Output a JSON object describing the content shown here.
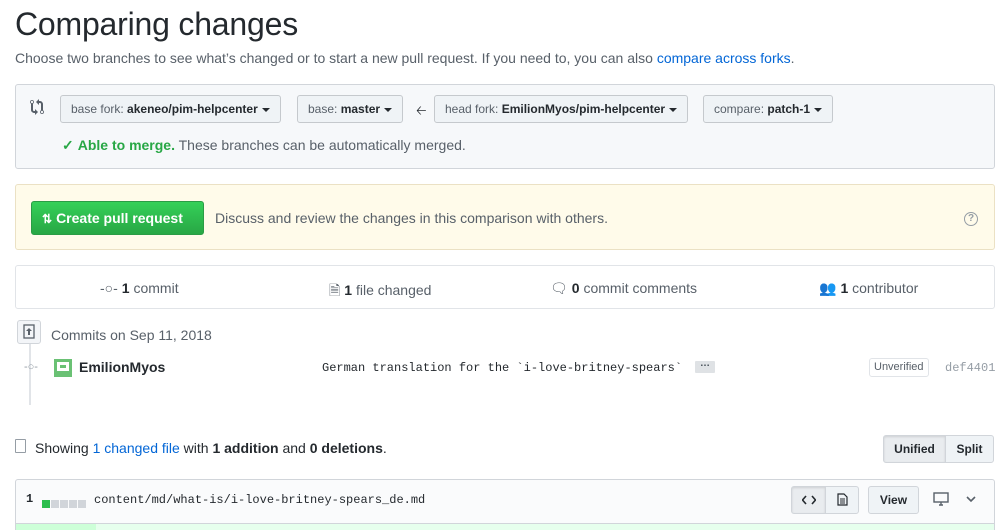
{
  "header": {
    "title": "Comparing changes",
    "subtitle": "Choose two branches to see what’s changed or to start a new pull request. If you need to, you can also ",
    "subtitle_link": "compare across forks",
    "subtitle_end": "."
  },
  "range": {
    "base_fork_label": "base fork:",
    "base_fork_value": "akeneo/pim-helpcenter",
    "base_label": "base:",
    "base_value": "master",
    "head_fork_label": "head fork:",
    "head_fork_value": "EmilionMyos/pim-helpcenter",
    "compare_label": "compare:",
    "compare_value": "patch-1",
    "merge_status": "Able to merge.",
    "merge_detail": " These branches can be automatically merged."
  },
  "blankslate": {
    "button_label": "Create pull request",
    "text": "Discuss and review the changes in this comparison with others."
  },
  "numbers": {
    "commits_count": "1",
    "commits_label": " commit",
    "files_count": "1",
    "files_label": " file changed",
    "comments_count": "0",
    "comments_label": " commit comments",
    "contributors_count": "1",
    "contributors_label": " contributor"
  },
  "commits": {
    "date_header": "Commits on Sep 11, 2018",
    "items": [
      {
        "author": "EmilionMyos",
        "message": "German translation for the `i-love-britney-spears`",
        "ellipsis": "…",
        "badge": "Unverified",
        "sha": "def4401"
      }
    ]
  },
  "summary": {
    "showing": "Showing ",
    "changed_link": "1 changed file",
    "with": " with ",
    "additions": "1 addition",
    "and": " and ",
    "deletions": "0 deletions",
    "end": "."
  },
  "view_toggle": {
    "unified": "Unified",
    "split": "Split"
  },
  "file": {
    "count": "1",
    "diffstat_additions": 1,
    "diffstat_total": 5,
    "path": "content/md/what-is/i-love-britney-spears_de.md",
    "view_label": "View"
  },
  "colors": {
    "accent_green": "#28a745",
    "link_blue": "#0366d6",
    "blankslate_bg": "#fffbea"
  }
}
